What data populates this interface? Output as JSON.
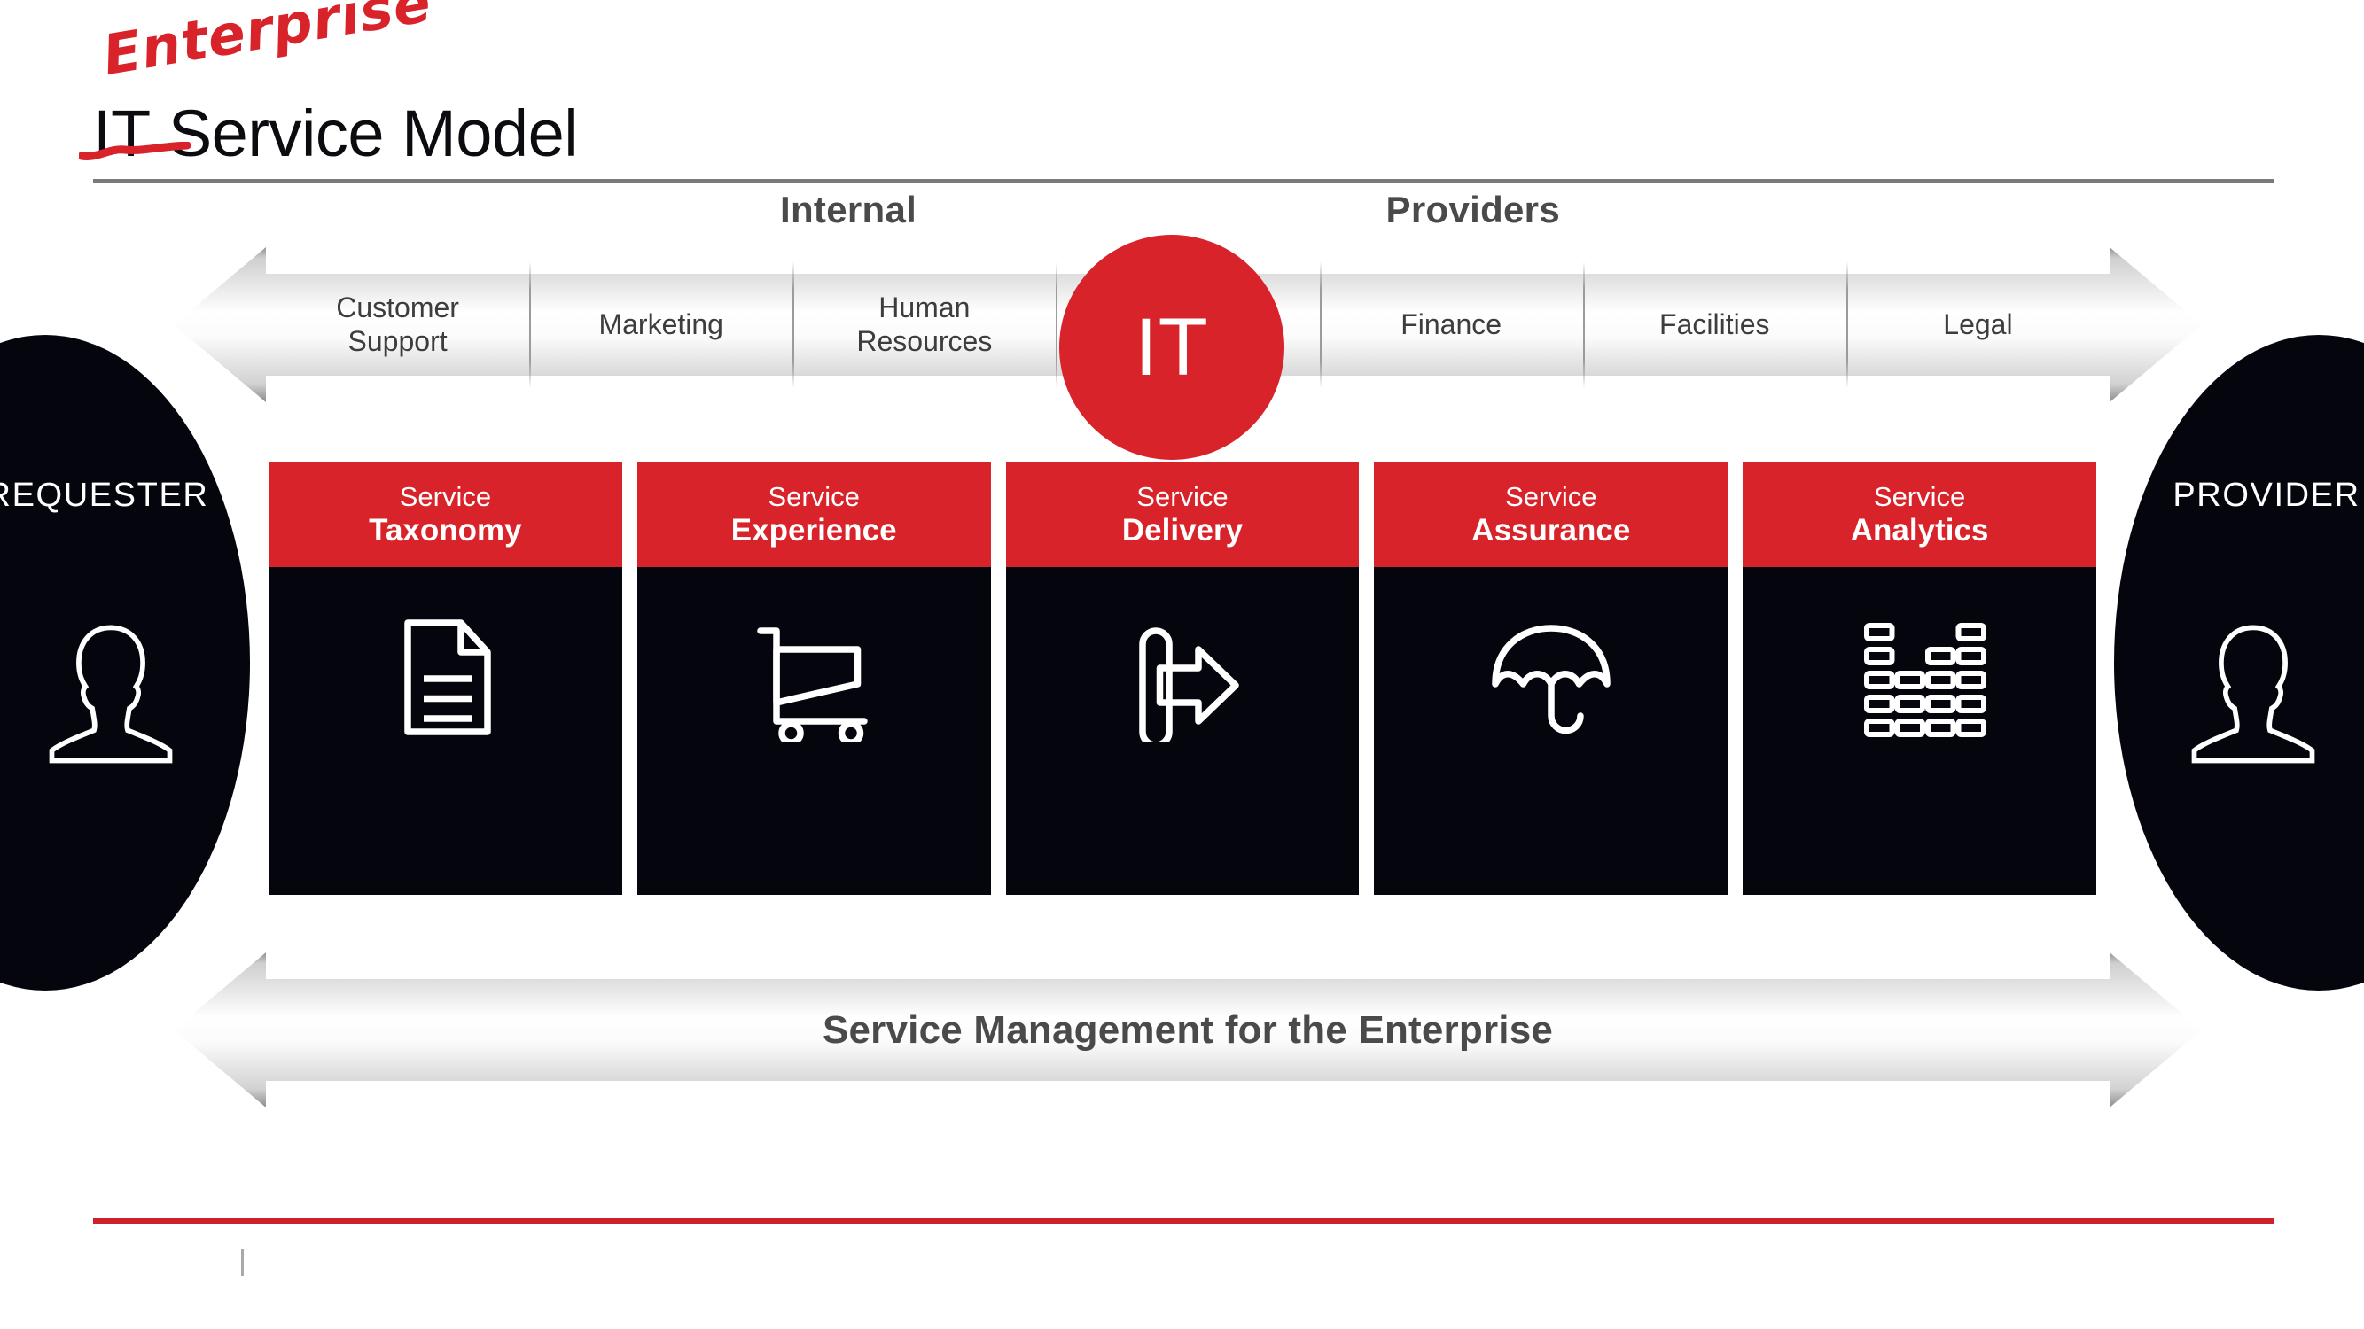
{
  "title": {
    "annotation": "Enterprise",
    "struck_word": "IT",
    "rest": " Service Model"
  },
  "providers_header": {
    "left": "Internal",
    "right": "Providers"
  },
  "top_arrow": {
    "segments": [
      {
        "label": "Customer\nSupport"
      },
      {
        "label": "Marketing"
      },
      {
        "label": "Human\nResources"
      },
      {
        "label": ""
      },
      {
        "label": "Finance"
      },
      {
        "label": "Facilities"
      },
      {
        "label": "Legal"
      }
    ],
    "center_badge": "IT"
  },
  "sides": {
    "requester": {
      "label": "REQUESTER",
      "icon": "person-icon"
    },
    "provider": {
      "label": "PROVIDER",
      "icon": "person-icon"
    }
  },
  "cards": [
    {
      "kicker": "Service",
      "name": "Taxonomy",
      "icon": "document-icon"
    },
    {
      "kicker": "Service",
      "name": "Experience",
      "icon": "shopping-cart-icon"
    },
    {
      "kicker": "Service",
      "name": "Delivery",
      "icon": "export-arrow-icon"
    },
    {
      "kicker": "Service",
      "name": "Assurance",
      "icon": "umbrella-icon"
    },
    {
      "kicker": "Service",
      "name": "Analytics",
      "icon": "equalizer-icon"
    }
  ],
  "bottom_arrow": {
    "label": "Service Management for the Enterprise"
  },
  "colors": {
    "accent_red": "#D8232A",
    "footer_red": "#CC2229",
    "card_dark": "#05060d",
    "gray_text": "#4a4a4a"
  }
}
